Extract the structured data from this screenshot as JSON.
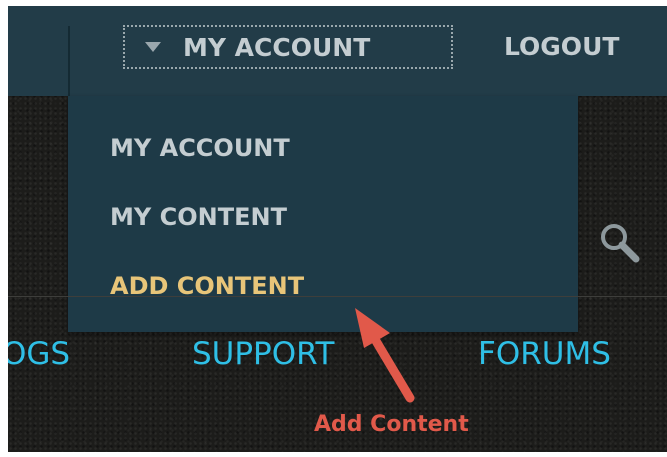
{
  "header": {
    "account_toggle_label": "MY ACCOUNT",
    "logout_label": "LOGOUT"
  },
  "dropdown": {
    "items": [
      {
        "label": "MY ACCOUNT"
      },
      {
        "label": "MY CONTENT"
      },
      {
        "label": "ADD CONTENT"
      }
    ]
  },
  "nav": {
    "items": [
      {
        "label": "OGS"
      },
      {
        "label": "SUPPORT"
      },
      {
        "label": "FORUMS"
      }
    ]
  },
  "annotation": {
    "label": "Add Content"
  },
  "icons": {
    "search": "search-icon",
    "account_toggle": "triangle-down-icon",
    "callout_arrow": "arrow-icon"
  },
  "colors": {
    "header_bg": "#223c48",
    "menu_text": "#c4cdd1",
    "active_item": "#e8c579",
    "nav_link": "#2fbfe6",
    "annotation": "#e1594a"
  }
}
